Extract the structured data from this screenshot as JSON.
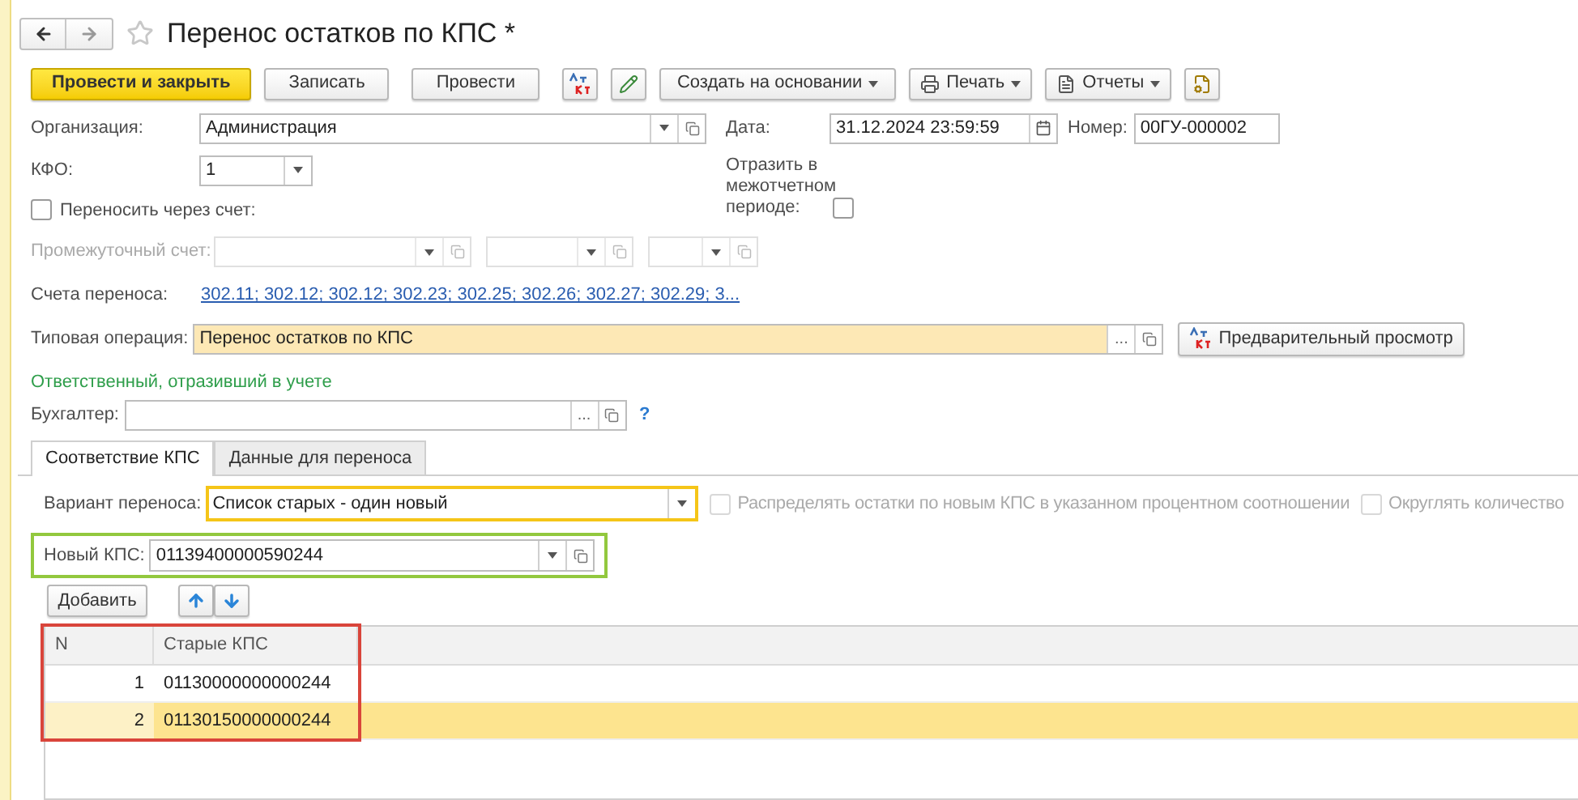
{
  "window": {
    "title": "Перенос остатков по КПС *"
  },
  "toolbar": [
    {
      "kind": "primary",
      "label": "Провести и закрыть"
    },
    {
      "kind": "button",
      "label": "Записать"
    },
    {
      "kind": "button",
      "label": "Провести"
    },
    {
      "kind": "icon-dtkt"
    },
    {
      "kind": "icon-pen"
    },
    {
      "kind": "menu",
      "label": "Создать на основании"
    },
    {
      "kind": "menu-print",
      "label": "Печать"
    },
    {
      "kind": "menu-report",
      "label": "Отчеты"
    },
    {
      "kind": "icon-doc"
    }
  ],
  "organization": {
    "label": "Организация:",
    "value": "Администрация"
  },
  "date": {
    "label": "Дата:",
    "value": "31.12.2024 23:59:59"
  },
  "number": {
    "label": "Номер:",
    "value": "00ГУ-000002"
  },
  "kfo": {
    "label": "КФО:",
    "value": "1"
  },
  "interperiod": {
    "label": "Отразить в межотчетном периоде:",
    "checked": false
  },
  "via_account": {
    "label": "Переносить через счет:",
    "checked": false
  },
  "intermediate_account": {
    "label": "Промежуточный счет:",
    "disabled": true
  },
  "transfer_accounts": {
    "label": "Счета переноса:",
    "link": "302.11; 302.12; 302.12; 302.23; 302.25; 302.26; 302.27; 302.29; 3..."
  },
  "typical_operation": {
    "label": "Типовая операция:",
    "value": "Перенос остатков по КПС",
    "button_dots": "...",
    "preview_button": "Предварительный просмотр"
  },
  "responsible": {
    "heading": "Ответственный, отразивший в учете",
    "label": "Бухгалтер:",
    "button_dots": "...",
    "help": "?"
  },
  "tabs": [
    {
      "label": "Соответствие КПС",
      "selected": true
    },
    {
      "label": "Данные для переноса",
      "selected": false
    }
  ],
  "variant": {
    "label": "Вариант переноса:",
    "value": "Список старых - один новый",
    "frame": {
      "color": "#f5c518"
    }
  },
  "options": [
    {
      "label": "Распределять остатки по новым КПС в указанном процентном соотношении",
      "checked": false,
      "disabled": true
    },
    {
      "label": "Округлять количество",
      "checked": false,
      "disabled": true
    }
  ],
  "new_kps": {
    "label": "Новый КПС:",
    "value": "01139400000590244",
    "frame": {
      "color": "#92c83e"
    }
  },
  "table_toolbar": {
    "add_button": "Добавить"
  },
  "table": {
    "frame": {
      "color": "#d9453b"
    },
    "columns": [
      "N",
      "Старые КПС"
    ],
    "rows": [
      {
        "n": "1",
        "kps": "01130000000000244",
        "selected": false
      },
      {
        "n": "2",
        "kps": "01130150000000244",
        "selected": true
      }
    ]
  }
}
